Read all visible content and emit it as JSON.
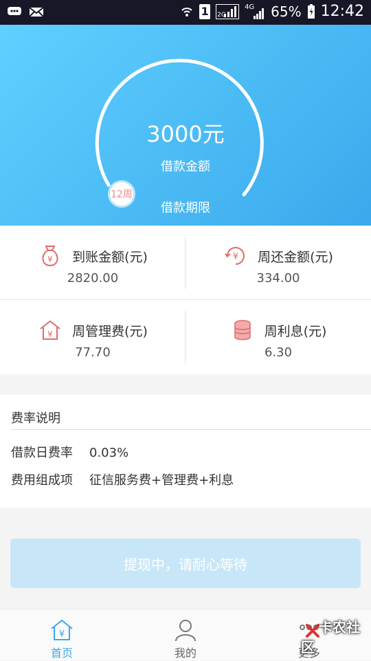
{
  "status_bar": {
    "signal_label": "1",
    "network_2g": "2G",
    "network_4g": "4G",
    "battery": "65%",
    "time": "12:42",
    "icons": [
      "chat-icon",
      "mail-icon",
      "wifi-icon",
      "sim-icon",
      "signal-icon",
      "battery-icon"
    ]
  },
  "hero": {
    "amount": "3000元",
    "amount_label": "借款金额",
    "term_value": "12周",
    "term_label": "借款期限",
    "colors": {
      "start": "#5fd0ff",
      "end": "#3aa9ec"
    }
  },
  "stats": [
    {
      "icon": "money-bag-icon",
      "title": "到账金额(元)",
      "value": "2820.00"
    },
    {
      "icon": "repay-cycle-icon",
      "title": "周还金额(元)",
      "value": "334.00"
    },
    {
      "icon": "house-yen-icon",
      "title": "周管理费(元)",
      "value": "77.70"
    },
    {
      "icon": "coin-stack-icon",
      "title": "周利息(元)",
      "value": "6.30"
    }
  ],
  "fee_section": {
    "title": "费率说明",
    "rows": [
      {
        "key": "借款日费率",
        "value": "0.03%"
      },
      {
        "key": "费用组成项",
        "value": "征信服务费+管理费+利息"
      }
    ]
  },
  "withdraw_button": {
    "label": "提现中，请耐心等待"
  },
  "bottom_nav": [
    {
      "icon": "home-yen-icon",
      "label": "首页",
      "active": true
    },
    {
      "icon": "user-icon",
      "label": "我的",
      "active": false
    },
    {
      "icon": "more-icon",
      "label": "更多",
      "active": false
    }
  ],
  "watermark": {
    "text": "卡农社区"
  },
  "accent_color": "#3aa9ec",
  "icon_color": "#e06b6b"
}
